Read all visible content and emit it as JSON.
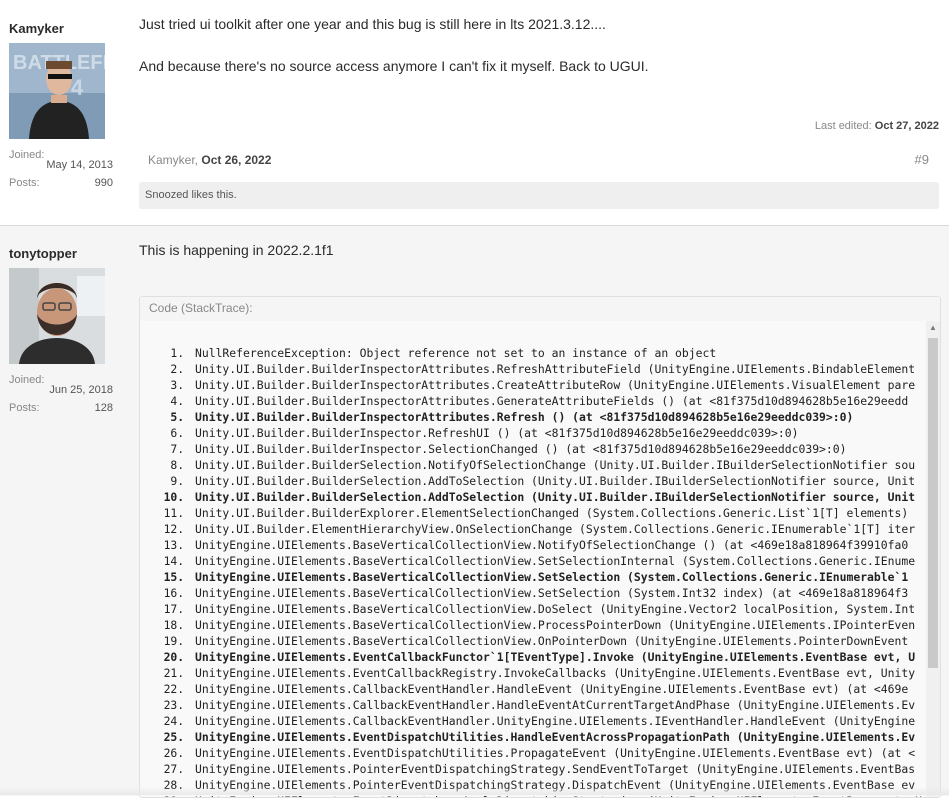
{
  "posts": [
    {
      "username": "Kamyker",
      "joined_label": "Joined:",
      "joined_value": "May 14, 2013",
      "posts_label": "Posts:",
      "posts_value": "990",
      "message_lines": [
        "Just tried ui toolkit after one year and this bug is still here in lts 2021.3.12....",
        "And because there's no source access anymore I can't fix it myself. Back to UGUI."
      ],
      "last_edited_label": "Last edited:",
      "last_edited_date": "Oct 27, 2022",
      "author_footer": "Kamyker,",
      "date": "Oct 26, 2022",
      "post_number": "#9",
      "likes": "Snoozed likes this."
    },
    {
      "username": "tonytopper",
      "joined_label": "Joined:",
      "joined_value": "Jun 25, 2018",
      "posts_label": "Posts:",
      "posts_value": "128",
      "message": "This is happening in 2022.2.1f1",
      "code_header": "Code (StackTrace):",
      "code_lines": [
        "NullReferenceException: Object reference not set to an instance of an object",
        "Unity.UI.Builder.BuilderInspectorAttributes.RefreshAttributeField (UnityEngine.UIElements.BindableElement",
        "Unity.UI.Builder.BuilderInspectorAttributes.CreateAttributeRow (UnityEngine.UIElements.VisualElement pare",
        "Unity.UI.Builder.BuilderInspectorAttributes.GenerateAttributeFields () (at <81f375d10d894628b5e16e29eedd",
        "Unity.UI.Builder.BuilderInspectorAttributes.Refresh () (at <81f375d10d894628b5e16e29eeddc039>:0)",
        "Unity.UI.Builder.BuilderInspector.RefreshUI () (at <81f375d10d894628b5e16e29eeddc039>:0)",
        "Unity.UI.Builder.BuilderInspector.SelectionChanged () (at <81f375d10d894628b5e16e29eeddc039>:0)",
        "Unity.UI.Builder.BuilderSelection.NotifyOfSelectionChange (Unity.UI.Builder.IBuilderSelectionNotifier sou",
        "Unity.UI.Builder.BuilderSelection.AddToSelection (Unity.UI.Builder.IBuilderSelectionNotifier source, Unit",
        "Unity.UI.Builder.BuilderSelection.AddToSelection (Unity.UI.Builder.IBuilderSelectionNotifier source, Unit",
        "Unity.UI.Builder.BuilderExplorer.ElementSelectionChanged (System.Collections.Generic.List`1[T] elements)",
        "Unity.UI.Builder.ElementHierarchyView.OnSelectionChange (System.Collections.Generic.IEnumerable`1[T] iter",
        "UnityEngine.UIElements.BaseVerticalCollectionView.NotifyOfSelectionChange () (at <469e18a818964f39910fa0",
        "UnityEngine.UIElements.BaseVerticalCollectionView.SetSelectionInternal (System.Collections.Generic.IEnume",
        "UnityEngine.UIElements.BaseVerticalCollectionView.SetSelection (System.Collections.Generic.IEnumerable`1",
        "UnityEngine.UIElements.BaseVerticalCollectionView.SetSelection (System.Int32 index) (at <469e18a818964f3",
        "UnityEngine.UIElements.BaseVerticalCollectionView.DoSelect (UnityEngine.Vector2 localPosition, System.Int",
        "UnityEngine.UIElements.BaseVerticalCollectionView.ProcessPointerDown (UnityEngine.UIElements.IPointerEven",
        "UnityEngine.UIElements.BaseVerticalCollectionView.OnPointerDown (UnityEngine.UIElements.PointerDownEvent",
        "UnityEngine.UIElements.EventCallbackFunctor`1[TEventType].Invoke (UnityEngine.UIElements.EventBase evt, U",
        "UnityEngine.UIElements.EventCallbackRegistry.InvokeCallbacks (UnityEngine.UIElements.EventBase evt, Unity",
        "UnityEngine.UIElements.CallbackEventHandler.HandleEvent (UnityEngine.UIElements.EventBase evt) (at <469e",
        "UnityEngine.UIElements.CallbackEventHandler.HandleEventAtCurrentTargetAndPhase (UnityEngine.UIElements.Ev",
        "UnityEngine.UIElements.CallbackEventHandler.UnityEngine.UIElements.IEventHandler.HandleEvent (UnityEngine",
        "UnityEngine.UIElements.EventDispatchUtilities.HandleEventAcrossPropagationPath (UnityEngine.UIElements.Ev",
        "UnityEngine.UIElements.EventDispatchUtilities.PropagateEvent (UnityEngine.UIElements.EventBase evt) (at <",
        "UnityEngine.UIElements.PointerEventDispatchingStrategy.SendEventToTarget (UnityEngine.UIElements.EventBas",
        "UnityEngine.UIElements.PointerEventDispatchingStrategy.DispatchEvent (UnityEngine.UIElements.EventBase ev",
        "UnityEngine.UIElements.EventDispatcher.ApplyDispatchingStrategies (UnityEngine.UIElements.EventBase evt, U"
      ]
    }
  ]
}
